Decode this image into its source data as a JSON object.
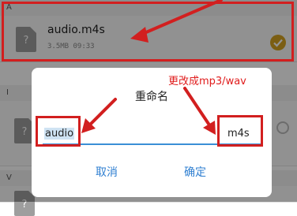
{
  "file_list": {
    "sections": [
      {
        "letter": "A"
      },
      {
        "letter": "I"
      },
      {
        "letter": "V"
      }
    ],
    "selected_file": {
      "name": "audio.m4s",
      "meta": "3.5MB  09:33",
      "icon": "file-unknown-icon"
    },
    "other_rows": [
      {
        "icon": "file-unknown-icon"
      },
      {
        "icon": "file-unknown-icon"
      }
    ]
  },
  "dialog": {
    "title": "重命名",
    "name_value": "audio",
    "extension_value": "m4s",
    "cancel_label": "取消",
    "confirm_label": "确定"
  },
  "annotations": {
    "note": "更改成mp3/wav",
    "color": "#d21f1f"
  },
  "colors": {
    "accent": "#2f7fd1",
    "check": "#d4a321"
  }
}
